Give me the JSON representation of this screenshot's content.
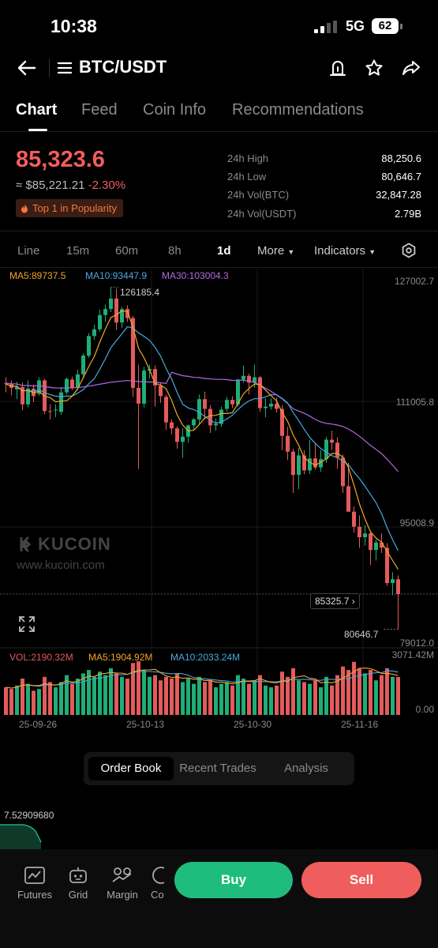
{
  "status_bar": {
    "time": "10:38",
    "network": "5G",
    "battery": "62"
  },
  "header": {
    "title": "BTC/USDT",
    "icons": [
      "back-arrow-icon",
      "menu-icon",
      "alert-icon",
      "star-icon",
      "share-icon"
    ]
  },
  "tabs": [
    {
      "label": "Chart",
      "active": true
    },
    {
      "label": "Feed"
    },
    {
      "label": "Coin Info"
    },
    {
      "label": "Recommendations"
    }
  ],
  "ticker": {
    "price": "85,323.6",
    "fiat": "≈ $85,221.21",
    "change": "-2.30%",
    "badge": "Top 1 in Popularity",
    "stats": [
      {
        "label": "24h High",
        "value": "88,250.6"
      },
      {
        "label": "24h Low",
        "value": "80,646.7"
      },
      {
        "label": "24h Vol(BTC)",
        "value": "32,847.28"
      },
      {
        "label": "24h Vol(USDT)",
        "value": "2.79B"
      }
    ]
  },
  "intervals": {
    "items": [
      "Line",
      "15m",
      "60m",
      "8h",
      "1d"
    ],
    "active": "1d",
    "more": "More",
    "indicators": "Indicators"
  },
  "chart_legend": {
    "ma5": "MA5:89737.5",
    "ma10": "MA10:93447.9",
    "ma30": "MA30:103004.3",
    "colors": {
      "ma5": "#f5a623",
      "ma10": "#4aa8e0",
      "ma30": "#b26be0",
      "up": "#1fae77",
      "down": "#e45b5b"
    }
  },
  "price_axis": {
    "top": "127002.7",
    "mid1": "111005.8",
    "mid2": "95008.9",
    "bottom": "79012.0"
  },
  "annotations": {
    "high": "126185.4",
    "low": "80646.7",
    "last": "85325.7"
  },
  "watermark": {
    "brand": "KUCOIN",
    "url": "www.kucoin.com"
  },
  "volume_legend": {
    "vol": "VOL:2190.32M",
    "ma5": "MA5:1904.92M",
    "ma10": "MA10:2033.24M",
    "max": "3071.42M",
    "min": "0.00"
  },
  "dates": [
    "25-09-26",
    "25-10-13",
    "25-10-30",
    "25-11-16"
  ],
  "chart_data": {
    "type": "candlestick",
    "ylim": [
      79012.0,
      127002.7
    ],
    "candles": [
      {
        "o": 113400,
        "h": 114200,
        "l": 112200,
        "c": 113300
      },
      {
        "o": 113300,
        "h": 113800,
        "l": 111800,
        "c": 112800
      },
      {
        "o": 112600,
        "h": 113600,
        "l": 111300,
        "c": 112900
      },
      {
        "o": 112900,
        "h": 113500,
        "l": 109800,
        "c": 110600
      },
      {
        "o": 110600,
        "h": 113800,
        "l": 110200,
        "c": 112700
      },
      {
        "o": 112700,
        "h": 113200,
        "l": 110900,
        "c": 111700
      },
      {
        "o": 112000,
        "h": 114200,
        "l": 111700,
        "c": 113800
      },
      {
        "o": 113800,
        "h": 114000,
        "l": 109300,
        "c": 109700
      },
      {
        "o": 109700,
        "h": 110600,
        "l": 108600,
        "c": 109600
      },
      {
        "o": 109800,
        "h": 110600,
        "l": 108900,
        "c": 109900
      },
      {
        "o": 109600,
        "h": 112900,
        "l": 109200,
        "c": 112200
      },
      {
        "o": 112200,
        "h": 114200,
        "l": 111900,
        "c": 114000
      },
      {
        "o": 113900,
        "h": 114300,
        "l": 112500,
        "c": 112800
      },
      {
        "o": 112800,
        "h": 115200,
        "l": 112500,
        "c": 114600
      },
      {
        "o": 114600,
        "h": 117400,
        "l": 114200,
        "c": 117100
      },
      {
        "o": 117100,
        "h": 120100,
        "l": 116800,
        "c": 119700
      },
      {
        "o": 119700,
        "h": 121200,
        "l": 119200,
        "c": 120600
      },
      {
        "o": 120600,
        "h": 123200,
        "l": 120300,
        "c": 122500
      },
      {
        "o": 122500,
        "h": 123900,
        "l": 121600,
        "c": 123300
      },
      {
        "o": 123300,
        "h": 126185.4,
        "l": 122900,
        "c": 124700
      },
      {
        "o": 124700,
        "h": 126000,
        "l": 120500,
        "c": 121500
      },
      {
        "o": 121500,
        "h": 123600,
        "l": 120800,
        "c": 123300
      },
      {
        "o": 123300,
        "h": 123800,
        "l": 121600,
        "c": 122100
      },
      {
        "o": 122100,
        "h": 122400,
        "l": 111600,
        "c": 112800
      },
      {
        "o": 112800,
        "h": 115900,
        "l": 102000,
        "c": 110700
      },
      {
        "o": 110700,
        "h": 115600,
        "l": 110200,
        "c": 115100
      },
      {
        "o": 115100,
        "h": 115900,
        "l": 114000,
        "c": 115300
      },
      {
        "o": 115300,
        "h": 115800,
        "l": 110300,
        "c": 113100
      },
      {
        "o": 113100,
        "h": 113500,
        "l": 110800,
        "c": 111700
      },
      {
        "o": 111600,
        "h": 111900,
        "l": 107200,
        "c": 108200
      },
      {
        "o": 108200,
        "h": 108600,
        "l": 106600,
        "c": 107400
      },
      {
        "o": 107400,
        "h": 107700,
        "l": 104700,
        "c": 105600
      },
      {
        "o": 105600,
        "h": 107400,
        "l": 103500,
        "c": 106300
      },
      {
        "o": 106300,
        "h": 107900,
        "l": 105500,
        "c": 107800
      },
      {
        "o": 107800,
        "h": 108800,
        "l": 107100,
        "c": 108600
      },
      {
        "o": 108600,
        "h": 111900,
        "l": 108000,
        "c": 111300
      },
      {
        "o": 111300,
        "h": 112300,
        "l": 108600,
        "c": 110000
      },
      {
        "o": 110000,
        "h": 110500,
        "l": 106800,
        "c": 107800
      },
      {
        "o": 107800,
        "h": 108700,
        "l": 107100,
        "c": 108000
      },
      {
        "o": 108000,
        "h": 110300,
        "l": 107600,
        "c": 109900
      },
      {
        "o": 110000,
        "h": 111600,
        "l": 109600,
        "c": 111200
      },
      {
        "o": 111200,
        "h": 111700,
        "l": 110100,
        "c": 110600
      },
      {
        "o": 110600,
        "h": 114000,
        "l": 110300,
        "c": 113900
      },
      {
        "o": 113900,
        "h": 115800,
        "l": 113500,
        "c": 114400
      },
      {
        "o": 114400,
        "h": 114700,
        "l": 111900,
        "c": 113500
      },
      {
        "o": 113500,
        "h": 115900,
        "l": 112800,
        "c": 114200
      },
      {
        "o": 114200,
        "h": 114400,
        "l": 109600,
        "c": 110100
      },
      {
        "o": 110100,
        "h": 111400,
        "l": 108900,
        "c": 110300
      },
      {
        "o": 110300,
        "h": 111400,
        "l": 109900,
        "c": 110700
      },
      {
        "o": 110700,
        "h": 111500,
        "l": 109500,
        "c": 110000
      },
      {
        "o": 110000,
        "h": 110500,
        "l": 104500,
        "c": 106400
      },
      {
        "o": 106400,
        "h": 107600,
        "l": 103200,
        "c": 104300
      },
      {
        "o": 104300,
        "h": 104700,
        "l": 98800,
        "c": 101200
      },
      {
        "o": 101200,
        "h": 104800,
        "l": 99300,
        "c": 103800
      },
      {
        "o": 103800,
        "h": 104500,
        "l": 101300,
        "c": 101800
      },
      {
        "o": 101800,
        "h": 105900,
        "l": 101300,
        "c": 103400
      },
      {
        "o": 103400,
        "h": 105400,
        "l": 101900,
        "c": 102200
      },
      {
        "o": 102200,
        "h": 104500,
        "l": 101600,
        "c": 103300
      },
      {
        "o": 103300,
        "h": 106300,
        "l": 102800,
        "c": 105900
      },
      {
        "o": 105900,
        "h": 107100,
        "l": 104500,
        "c": 105500
      },
      {
        "o": 105500,
        "h": 106200,
        "l": 102000,
        "c": 103500
      },
      {
        "o": 103500,
        "h": 103900,
        "l": 98800,
        "c": 99700
      },
      {
        "o": 99700,
        "h": 102800,
        "l": 97600,
        "c": 96300
      },
      {
        "o": 96300,
        "h": 97000,
        "l": 93500,
        "c": 94300
      },
      {
        "o": 94300,
        "h": 95800,
        "l": 91500,
        "c": 92900
      },
      {
        "o": 92900,
        "h": 94500,
        "l": 91800,
        "c": 93400
      },
      {
        "o": 93400,
        "h": 93800,
        "l": 89200,
        "c": 91200
      },
      {
        "o": 91200,
        "h": 92600,
        "l": 89800,
        "c": 92200
      },
      {
        "o": 92200,
        "h": 93400,
        "l": 90800,
        "c": 91500
      },
      {
        "o": 91500,
        "h": 92100,
        "l": 86400,
        "c": 86800
      },
      {
        "o": 86800,
        "h": 88250.6,
        "l": 85200,
        "c": 87300
      },
      {
        "o": 87300,
        "h": 87800,
        "l": 80646.7,
        "c": 85323.6
      }
    ],
    "volumes": [
      1.6,
      1.5,
      1.7,
      2.1,
      1.8,
      1.4,
      1.5,
      2.2,
      1.9,
      1.6,
      1.9,
      2.3,
      1.8,
      2.1,
      2.4,
      2.6,
      2.2,
      2.5,
      2.3,
      2.7,
      2.4,
      2.2,
      2.1,
      3.0,
      3.1,
      2.6,
      2.2,
      2.3,
      2.0,
      2.2,
      2.1,
      2.4,
      1.9,
      2.1,
      1.8,
      2.2,
      1.9,
      2.0,
      1.6,
      1.8,
      1.9,
      1.7,
      2.3,
      2.1,
      1.8,
      2.0,
      2.3,
      1.7,
      1.6,
      1.7,
      2.5,
      2.2,
      2.7,
      2.0,
      1.9,
      1.8,
      2.0,
      1.6,
      2.2,
      1.7,
      2.3,
      2.8,
      2.6,
      3.07,
      2.7,
      2.4,
      2.6,
      2.0,
      2.3,
      2.7,
      2.2,
      2.19
    ]
  },
  "segmented": [
    "Order Book",
    "Recent Trades",
    "Analysis"
  ],
  "depth": {
    "value": "7.52909680"
  },
  "bottom_nav": [
    {
      "label": "Futures",
      "icon": "futures-icon"
    },
    {
      "label": "Grid",
      "icon": "grid-bot-icon"
    },
    {
      "label": "Margin",
      "icon": "margin-icon"
    },
    {
      "label": "Co",
      "icon": "convert-icon"
    }
  ],
  "actions": {
    "buy": "Buy",
    "sell": "Sell"
  }
}
